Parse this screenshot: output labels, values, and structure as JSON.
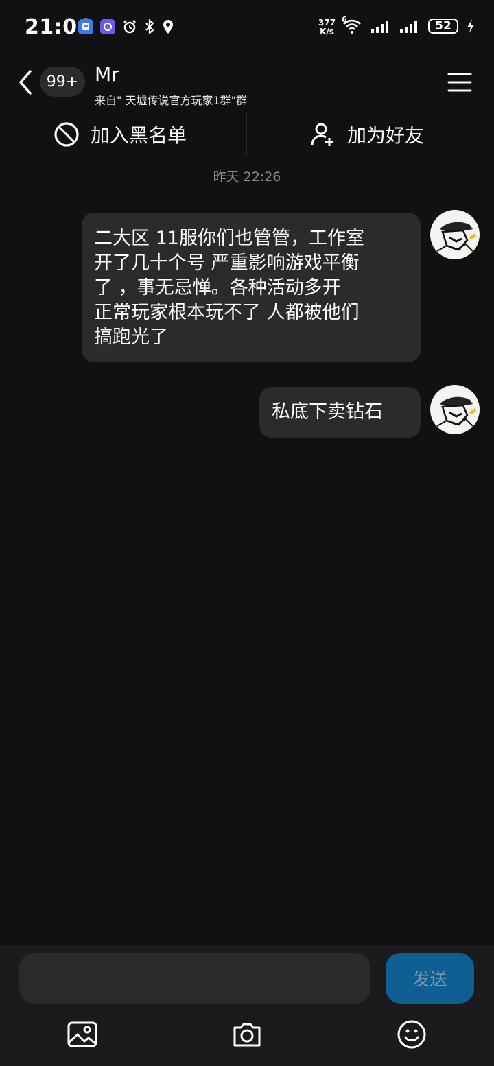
{
  "status_bar": {
    "time": "21:06",
    "net_speed_value": "377",
    "net_speed_unit": "K/s",
    "wifi_label": "6",
    "battery": "52"
  },
  "header": {
    "unread_badge": "99+",
    "contact_name": "Mr",
    "contact_source": "来自\" 天墟传说官方玩家1群\"群"
  },
  "actions": {
    "blacklist_label": "加入黑名单",
    "add_friend_label": "加为好友"
  },
  "chat": {
    "timestamp": "昨天 22:26",
    "messages": [
      {
        "lines": [
          "二大区 11服你们也管管，工作室",
          "开了几十个号 严重影响游戏平衡",
          "了  ，事无忌惮。各种活动多开",
          "正常玩家根本玩不了 人都被他们",
          "搞跑光了"
        ]
      },
      {
        "lines": [
          "私底下卖钻石"
        ]
      }
    ]
  },
  "composer": {
    "input_value": "",
    "send_label": "发送"
  },
  "icons": {
    "back": "back-chevron-icon",
    "menu": "hamburger-menu-icon",
    "blacklist": "prohibited-icon",
    "add_friend": "add-user-icon",
    "image": "image-icon",
    "camera": "camera-icon",
    "emoji": "emoji-icon"
  },
  "colors": {
    "background": "#111113",
    "bubble": "#2b2b2e",
    "send_button": "#0f5f93",
    "timestamp": "#8b8b90"
  }
}
